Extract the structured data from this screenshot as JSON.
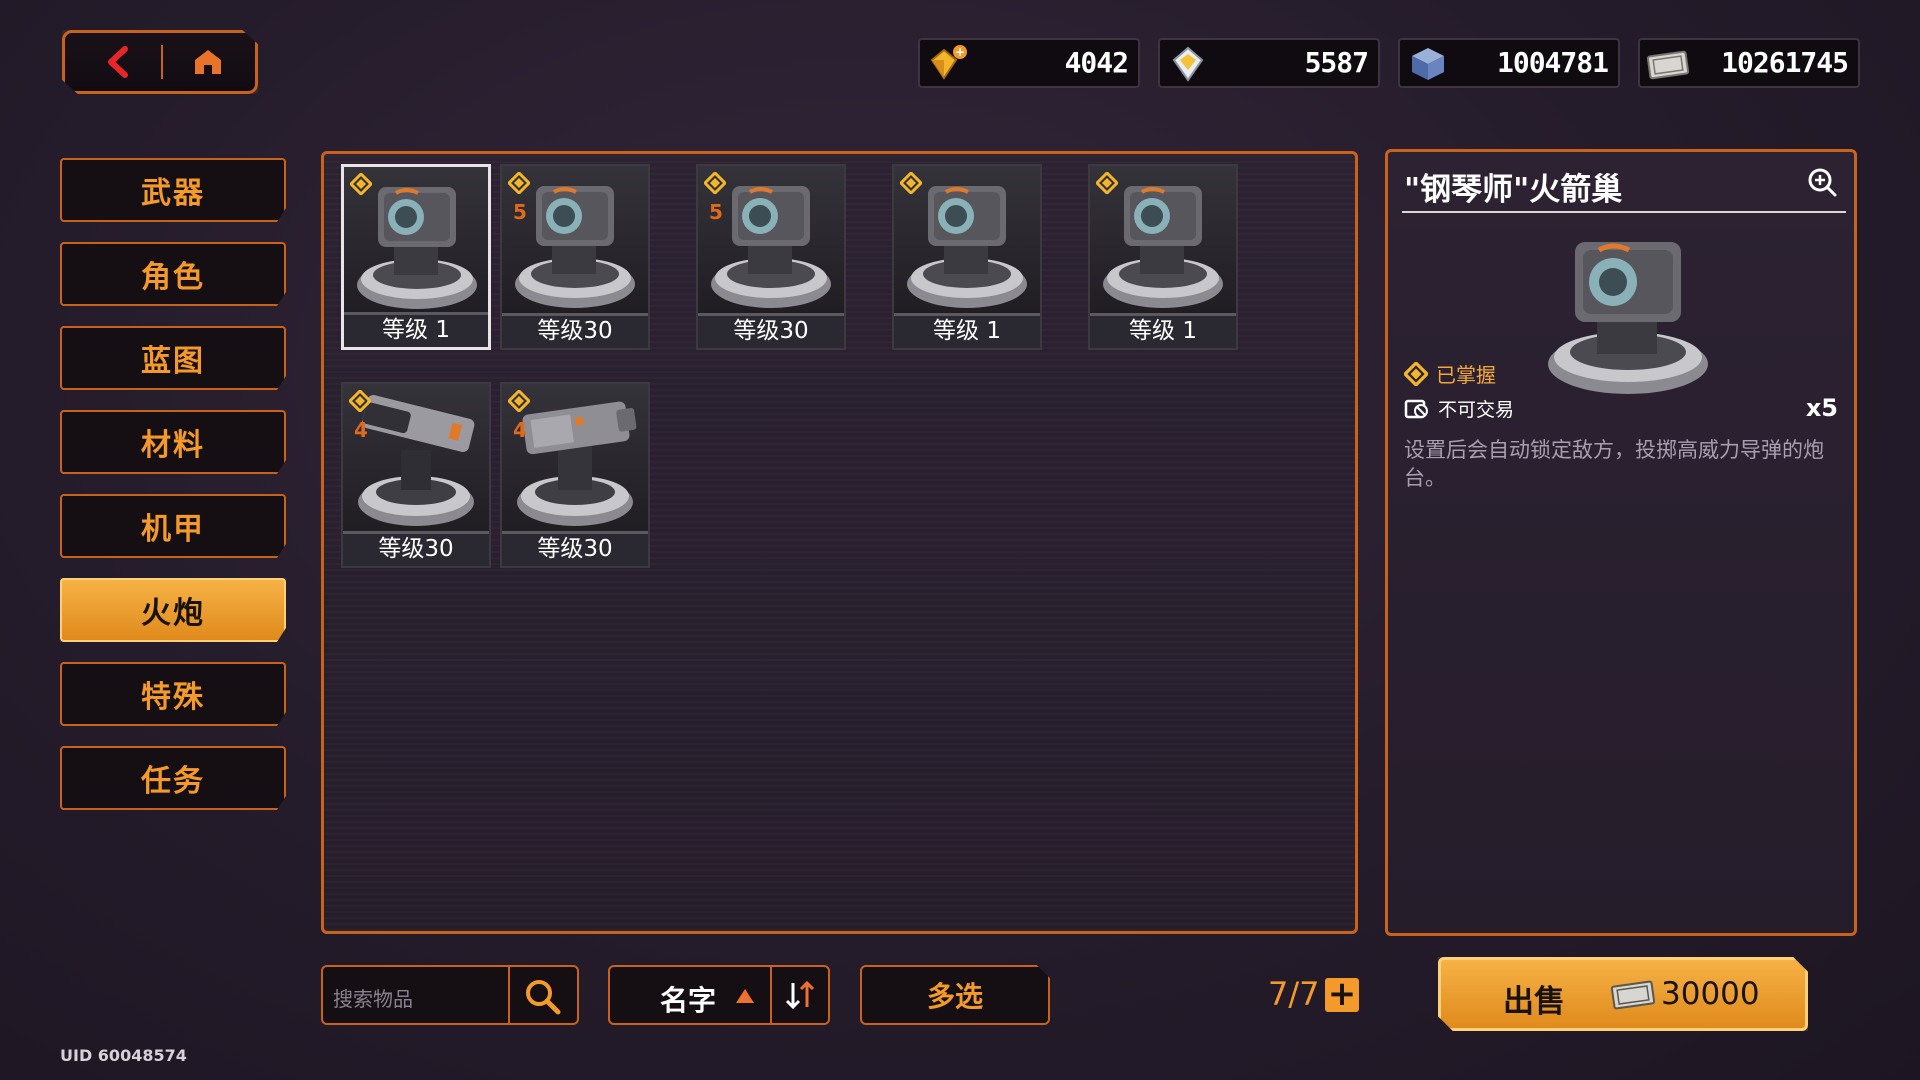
{
  "nav": {
    "back_icon": "back-arrow-icon",
    "home_icon": "home-icon"
  },
  "currencies": [
    {
      "icon": "gold-gem-plus-icon",
      "value": "4042"
    },
    {
      "icon": "silver-gem-icon",
      "value": "5587"
    },
    {
      "icon": "blue-cube-icon",
      "value": "1004781"
    },
    {
      "icon": "ticket-icon",
      "value": "10261745"
    }
  ],
  "menu": {
    "items": [
      {
        "label": "武器"
      },
      {
        "label": "角色"
      },
      {
        "label": "蓝图"
      },
      {
        "label": "材料"
      },
      {
        "label": "机甲"
      },
      {
        "label": "火炮",
        "active": true
      },
      {
        "label": "特殊"
      },
      {
        "label": "任务"
      }
    ]
  },
  "inventory": {
    "items": [
      {
        "level": "等级 1",
        "stars": "",
        "selected": true
      },
      {
        "level": "等级30",
        "stars": "5"
      },
      {
        "level": "等级30",
        "stars": "5"
      },
      {
        "level": "等级 1",
        "stars": ""
      },
      {
        "level": "等级 1",
        "stars": ""
      },
      {
        "level": "等级30",
        "stars": "4"
      },
      {
        "level": "等级30",
        "stars": "4"
      }
    ]
  },
  "detail": {
    "title": "\"钢琴师\"火箭巢",
    "mastered": "已掌握",
    "tradable": "不可交易",
    "quantity": "x5",
    "description": "设置后会自动锁定敌方，投掷高威力导弹的炮台。"
  },
  "bottom": {
    "search_placeholder": "搜索物品",
    "sort_label": "名字",
    "multi_label": "多选",
    "count": "7/7",
    "plus": "+",
    "sell_label": "出售",
    "sell_price": "30000"
  },
  "uid": "UID 60048574",
  "colors": {
    "accent": "#f39a2a",
    "border": "#c9631c",
    "active_bg": "#f0a235"
  }
}
